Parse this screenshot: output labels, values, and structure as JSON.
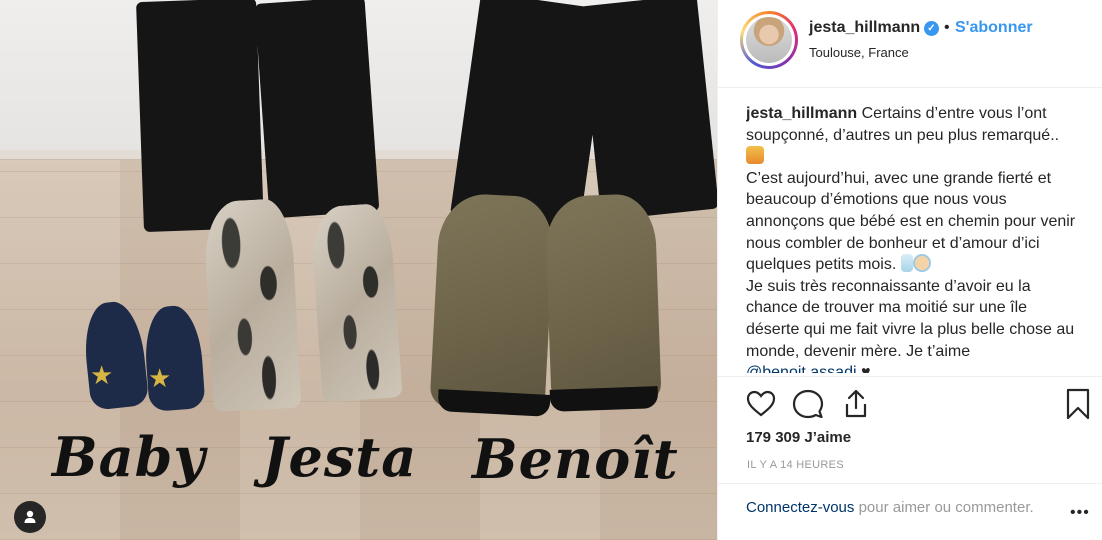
{
  "post": {
    "image_captions": {
      "baby": "Baby",
      "jesta": "Jesta",
      "benoit": "Benoît"
    }
  },
  "header": {
    "username": "jesta_hillmann",
    "separator": "•",
    "follow_label": "S'abonner",
    "location": "Toulouse, France"
  },
  "caption": {
    "username": "jesta_hillmann",
    "line1": "Certains d’entre vous l’ont soupçonné, d’autres un peu plus remarqué..",
    "line2": "C’est aujourd’hui, avec une grande fierté et beaucoup d’émotions que nous vous annonçons que bébé est en chemin pour venir nous combler de bonheur et d’amour d’ici quelques petits mois.",
    "line3": "Je suis très reconnaissante d’avoir eu la chance de trouver ma moitié sur une île déserte qui me fait vivre la plus belle chose au monde, devenir mère. Je t’aime",
    "mention": "@benoit.assadi"
  },
  "engagement": {
    "likes": "179 309 J’aime",
    "time_ago": "IL Y A 14 HEURES"
  },
  "login_prompt": {
    "link": "Connectez-vous",
    "text": " pour aimer ou commenter."
  },
  "more_menu": "•••",
  "icons": {
    "like": "heart-icon",
    "comment": "comment-icon",
    "share": "share-icon",
    "save": "bookmark-icon",
    "verified": "verified-badge-icon",
    "user_tag": "user-tag-icon"
  },
  "colors": {
    "link_blue": "#3897f0",
    "mention_blue": "#003569",
    "text": "#262626",
    "muted": "#999999"
  }
}
